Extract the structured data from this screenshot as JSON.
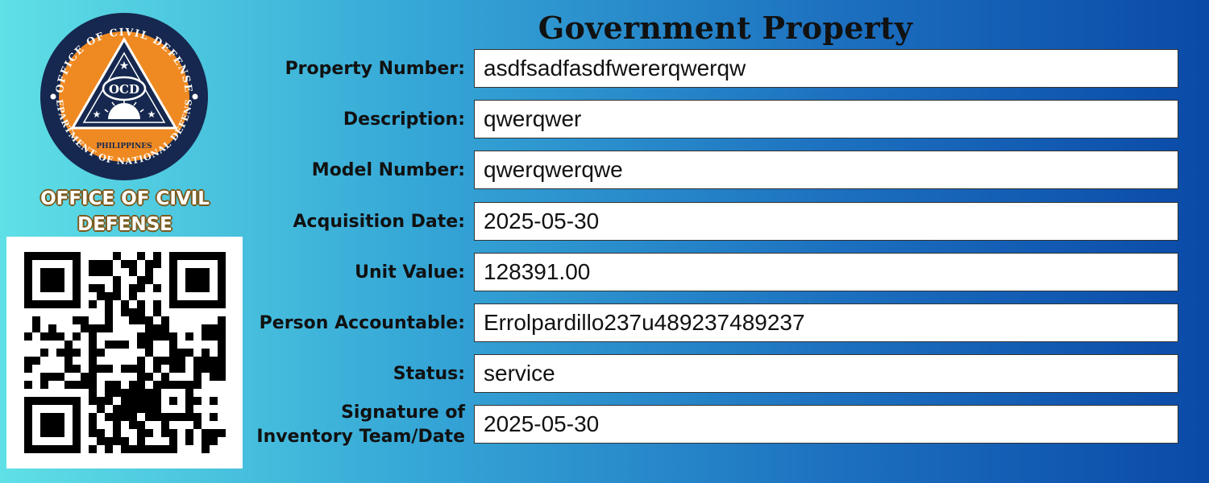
{
  "title": "Government Property",
  "organization": {
    "name": "OFFICE OF CIVIL DEFENSE",
    "seal_text_top": "OFFICE OF CIVIL DEFENSE",
    "seal_text_bottom": "DEPARTMENT OF NATIONAL DEFENSE",
    "seal_acronym": "OCD",
    "seal_country": "PHILIPPINES"
  },
  "fields": [
    {
      "label": "Property Number:",
      "value": "asdfsadfasdfwererqwerqw"
    },
    {
      "label": "Description:",
      "value": "qwerqwer"
    },
    {
      "label": "Model Number:",
      "value": "qwerqwerqwe"
    },
    {
      "label": "Acquisition Date:",
      "value": "2025-05-30"
    },
    {
      "label": "Unit Value:",
      "value": "128391.00"
    },
    {
      "label": "Person Accountable:",
      "value": "Errolpardillo237u489237489237"
    },
    {
      "label": "Status:",
      "value": "service"
    },
    {
      "label": "Signature of Inventory Team/Date",
      "value": "2025-05-30"
    }
  ],
  "colors": {
    "seal_orange": "#ef8a22",
    "seal_navy": "#16284f",
    "frame": "#333333"
  }
}
